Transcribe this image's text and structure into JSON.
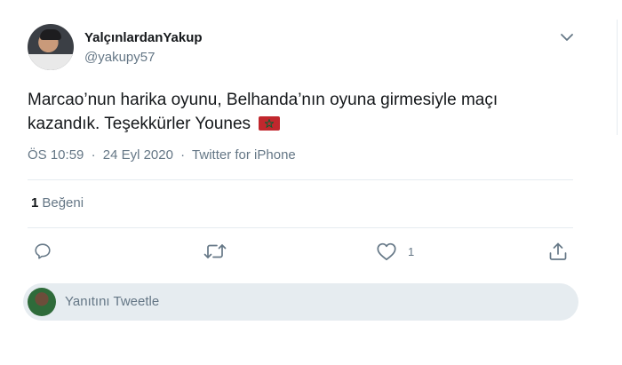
{
  "tweet": {
    "display_name": "YalçınlardanYakup",
    "handle": "@yakupy57",
    "text_line1": "Marcao’nun harika oyunu, Belhanda’nın oyuna girmesiyle maçı",
    "text_line2": "kazandık. Teşekkürler Younes",
    "flag_emoji": "moroccan-flag-icon",
    "time": "ÖS 10:59",
    "separator": "·",
    "date": "24 Eyl 2020",
    "source": "Twitter for iPhone"
  },
  "stats": {
    "likes_count": "1",
    "likes_label": "Beğeni"
  },
  "actions": {
    "reply_icon": "reply-icon",
    "retweet_icon": "retweet-icon",
    "like_icon": "heart-icon",
    "like_count": "1",
    "share_icon": "share-icon"
  },
  "reply": {
    "placeholder": "Yanıtını Tweetle"
  },
  "colors": {
    "text_primary": "#14171a",
    "text_secondary": "#657786",
    "divider": "#e6ecf0",
    "flag_red": "#c1272d",
    "flag_star": "#006233"
  }
}
